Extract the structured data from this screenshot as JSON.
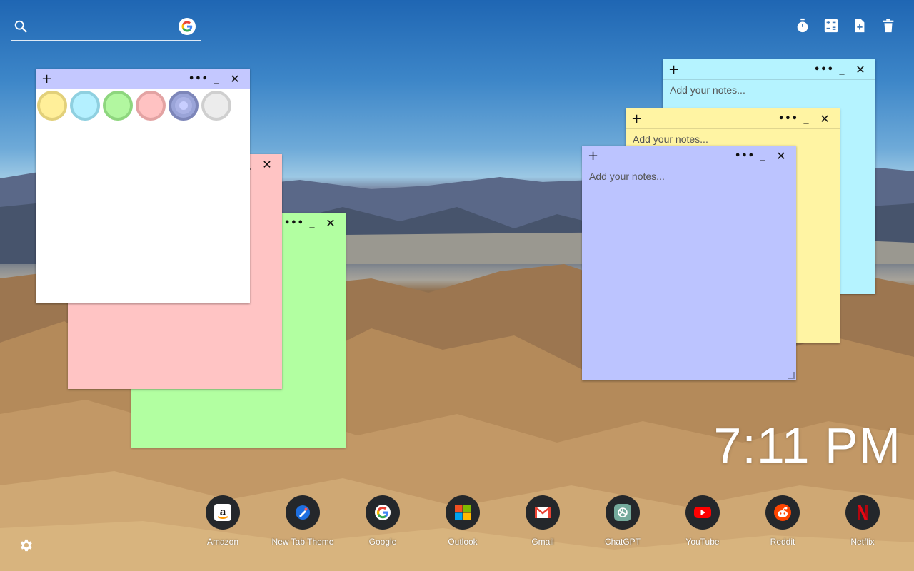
{
  "search": {
    "placeholder": "",
    "value": ""
  },
  "tools": [
    {
      "name": "timer-icon"
    },
    {
      "name": "calculator-icon"
    },
    {
      "name": "add-note-icon"
    },
    {
      "name": "trash-icon"
    }
  ],
  "notes": {
    "placeholder": "Add your notes...",
    "plus": "+",
    "menu": "•••",
    "minimize": "_",
    "close": "✕",
    "palette": [
      "#ffef99",
      "#b4f0ff",
      "#b2f7a0",
      "#ffc2c2",
      "#9aa4d8",
      "#ececec"
    ]
  },
  "clock": {
    "time": "7:11 PM"
  },
  "shortcuts": [
    {
      "label": "Amazon",
      "icon": "amazon-icon"
    },
    {
      "label": "New Tab Theme",
      "icon": "new-tab-theme-icon"
    },
    {
      "label": "Google",
      "icon": "google-icon"
    },
    {
      "label": "Outlook",
      "icon": "outlook-icon"
    },
    {
      "label": "Gmail",
      "icon": "gmail-icon"
    },
    {
      "label": "ChatGPT",
      "icon": "chatgpt-icon"
    },
    {
      "label": "YouTube",
      "icon": "youtube-icon"
    },
    {
      "label": "Reddit",
      "icon": "reddit-icon"
    },
    {
      "label": "Netflix",
      "icon": "netflix-icon"
    }
  ],
  "settings": {
    "icon": "gear-icon"
  }
}
